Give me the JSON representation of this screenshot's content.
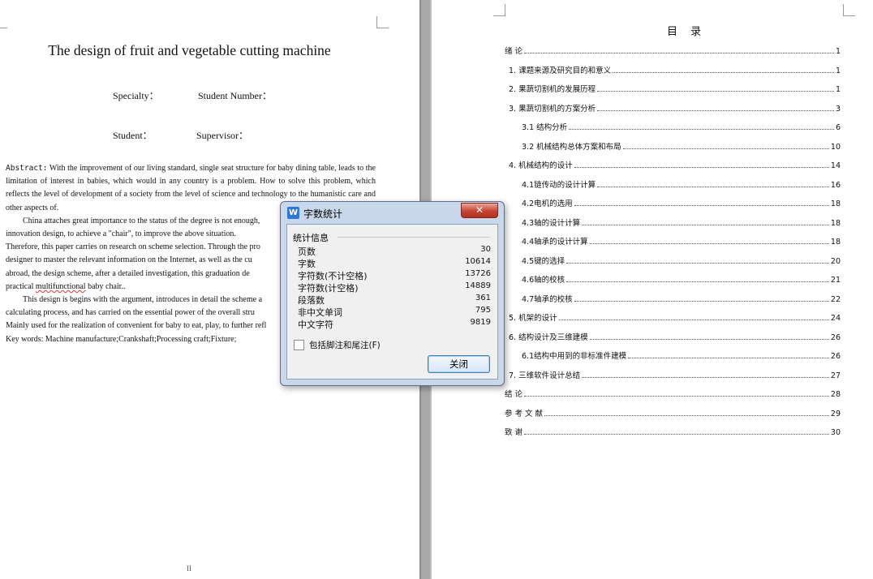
{
  "left_page": {
    "title": "The design of fruit and vegetable cutting machine",
    "specialty_label": "Specialty：",
    "student_number_label": "Student Number：",
    "student_label": "Student：",
    "supervisor_label": "Supervisor：",
    "abstract_label": "Abstract:",
    "abstract_p1": " With the improvement of our living standard, single seat structure for baby dining table, leads to the limitation of interest in babies, which would in any country is a problem. How to solve this problem, which reflects the level of development of a society from the level of science and technology to the humanistic care and other aspects of.",
    "abstract_p2": "China attaches great importance to the status of the degree is not enough,",
    "abstract_p2b": "innovation design, to achieve a \"chair\", to improve the above situation.",
    "abstract_p3": "Therefore, this paper carries on research on scheme selection. Through the pro",
    "abstract_p3b": "designer to master the relevant information on the Internet, as well as the cu",
    "abstract_p3c": "abroad, the design scheme, after a detailed investigation, this graduation de",
    "abstract_p3d_pre": "practical ",
    "abstract_p3d_sq": "multifunctional",
    "abstract_p3d_post": " baby chair..",
    "abstract_p4": "This design is begins with the argument, introduces in detail the scheme a",
    "abstract_p4b": "calculating process, and has carried on the essential power of the overall stru",
    "abstract_p4c": "Mainly used for the realization of convenient for baby to eat, play, to further refl",
    "keywords": "Key words:  Machine manufacture;Crankshaft;Processing craft;Fixture;",
    "page_number": "II"
  },
  "right_page": {
    "toc_title": "目 录",
    "toc": [
      {
        "text": "绪  论",
        "page": "1",
        "indent": 0
      },
      {
        "text": "1.  课题来源及研究目的和意义",
        "page": "1",
        "indent": 1
      },
      {
        "text": "2.  果蔬切割机的发展历程",
        "page": "1",
        "indent": 1
      },
      {
        "text": "3.  果蔬切割机的方案分析",
        "page": "3",
        "indent": 1
      },
      {
        "text": "3.1  结构分析",
        "page": "6",
        "indent": 2
      },
      {
        "text": "3.2  机械结构总体方案和布局",
        "page": "10",
        "indent": 2
      },
      {
        "text": "4.  机械结构的设计",
        "page": "14",
        "indent": 1
      },
      {
        "text": "4.1链传动的设计计算",
        "page": "16",
        "indent": 2
      },
      {
        "text": "4.2电机的选用",
        "page": "18",
        "indent": 2
      },
      {
        "text": "4.3轴的设计计算",
        "page": "18",
        "indent": 2
      },
      {
        "text": "4.4轴承的设计计算",
        "page": "18",
        "indent": 2
      },
      {
        "text": "4.5键的选择",
        "page": "20",
        "indent": 2
      },
      {
        "text": "4.6轴的校核",
        "page": "21",
        "indent": 2
      },
      {
        "text": "4.7轴承的校核",
        "page": "22",
        "indent": 2
      },
      {
        "text": "5.  机架的设计",
        "page": "24",
        "indent": 1
      },
      {
        "text": "6.  结构设计及三维建模",
        "page": "26",
        "indent": 1
      },
      {
        "text": "6.1结构中用到的非标准件建模",
        "page": "26",
        "indent": 2
      },
      {
        "text": "7.  三维软件设计总结",
        "page": "27",
        "indent": 1
      },
      {
        "text": "结  论",
        "page": "28",
        "indent": 0
      },
      {
        "text": "参 考 文 献",
        "page": "29",
        "indent": 0
      },
      {
        "text": "致  谢",
        "page": "30",
        "indent": 0
      }
    ]
  },
  "dialog": {
    "icon": "W",
    "title": "字数统计",
    "close_icon": "✕",
    "group_label": "统计信息",
    "stats": [
      {
        "label": "页数",
        "value": "30"
      },
      {
        "label": "字数",
        "value": "10614"
      },
      {
        "label": "字符数(不计空格)",
        "value": "13726"
      },
      {
        "label": "字符数(计空格)",
        "value": "14889"
      },
      {
        "label": "段落数",
        "value": "361"
      },
      {
        "label": "非中文单词",
        "value": "795"
      },
      {
        "label": "中文字符",
        "value": "9819"
      }
    ],
    "checkbox_label": "包括脚注和尾注(F)",
    "checkbox_checked": false,
    "close_button_label": "关闭"
  }
}
